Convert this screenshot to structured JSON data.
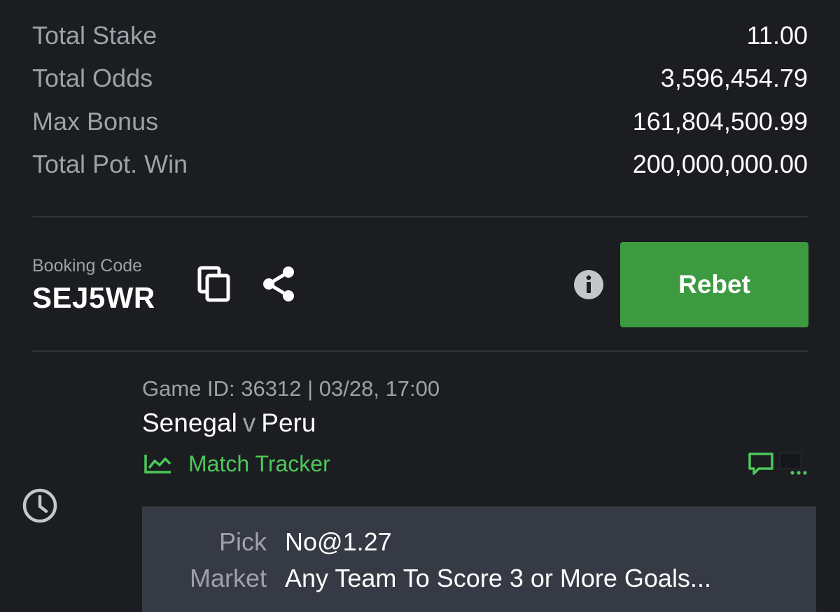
{
  "summary": {
    "rows": [
      {
        "label": "Total Stake",
        "value": "11.00"
      },
      {
        "label": "Total Odds",
        "value": "3,596,454.79"
      },
      {
        "label": "Max Bonus",
        "value": "161,804,500.99"
      },
      {
        "label": "Total Pot. Win",
        "value": "200,000,000.00"
      }
    ]
  },
  "booking": {
    "label": "Booking Code",
    "code": "SEJ5WR"
  },
  "actions": {
    "rebet_label": "Rebet"
  },
  "game": {
    "meta": "Game ID: 36312 | 03/28, 17:00",
    "home": "Senegal",
    "vs": "v",
    "away": "Peru",
    "tracker_label": "Match Tracker",
    "more": "..."
  },
  "selection": {
    "pick_label": "Pick",
    "pick_value": "No@1.27",
    "market_label": "Market",
    "market_value": "Any Team To Score 3 or More Goals..."
  },
  "icons": {
    "copy": "copy-icon",
    "share": "share-icon",
    "info": "info-icon",
    "tracker": "chart-line-icon",
    "comment": "comment-icon",
    "more": "more-icon",
    "clock": "clock-icon"
  },
  "colors": {
    "background": "#1b1d21",
    "accent_green": "#3d9a41",
    "tracker_green": "#4cc85a",
    "muted_text": "#9ea1a8",
    "pick_box": "#363a44"
  }
}
